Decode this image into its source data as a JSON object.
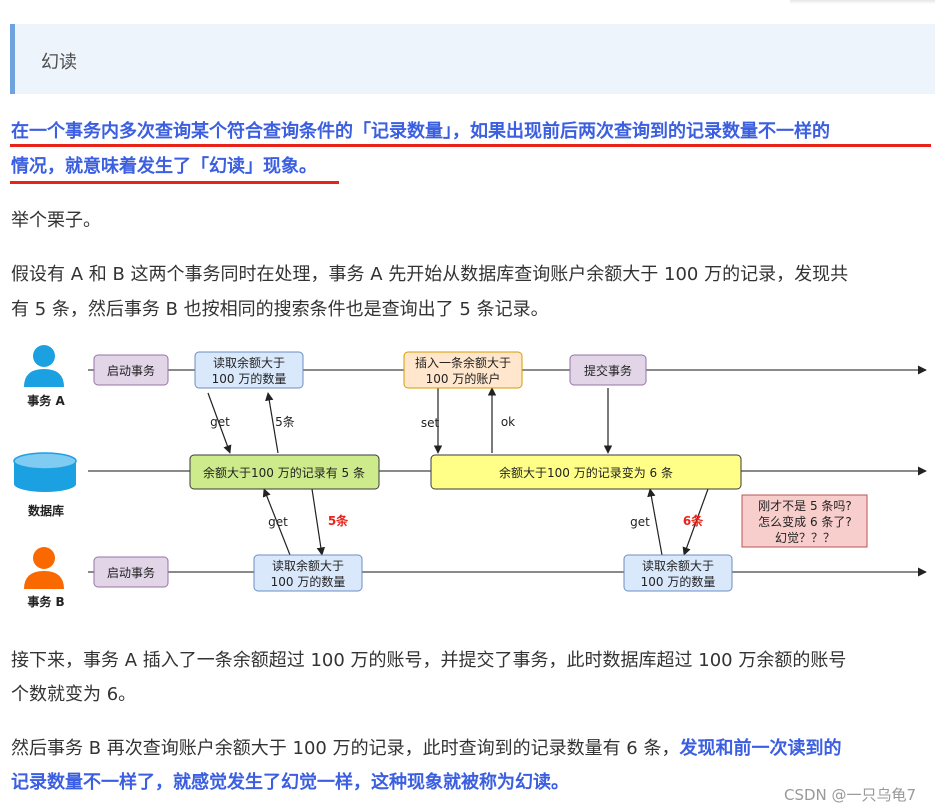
{
  "callout": {
    "text": "幻读"
  },
  "highlight": {
    "line1": "在一个事务内多次查询某个符合查询条件的「记录数量」，如果出现前后两次查询到的记录数量不一样的",
    "line2": "情况，就意味着发生了「幻读」现象。"
  },
  "example": "举个栗子。",
  "para1": {
    "line1": "假设有 A 和 B 这两个事务同时在处理，事务 A 先开始从数据库查询账户余额大于 100 万的记录，发现共",
    "line2": "有 5 条，然后事务 B 也按相同的搜索条件也是查询出了 5 条记录。"
  },
  "diagram": {
    "actors": {
      "a": "事务 A",
      "db": "数据库",
      "b": "事务 B"
    },
    "boxes": {
      "a_start": "启动事务",
      "a_read_l1": "读取余额大于",
      "a_read_l2": "100 万的数量",
      "a_insert_l1": "插入一条余额大于",
      "a_insert_l2": "100 万的账户",
      "a_commit": "提交事务",
      "db_5": "余额大于100 万的记录有 5 条",
      "db_6": "余额大于100 万的记录变为 6 条",
      "b_start": "启动事务",
      "b_read1_l1": "读取余额大于",
      "b_read1_l2": "100 万的数量",
      "b_read2_l1": "读取余额大于",
      "b_read2_l2": "100 万的数量",
      "note_l1": "刚才不是 5 条吗?",
      "note_l2": "怎么变成 6 条了?",
      "note_l3": "幻觉？？？"
    },
    "labels": {
      "get1": "get",
      "five1": "5条",
      "set": "set",
      "ok": "ok",
      "get2": "get",
      "five2": "5条",
      "get3": "get",
      "six": "6条"
    },
    "colors": {
      "start": "#e1d5e7",
      "read": "#dae8fc",
      "insert": "#ffe6cc",
      "db5": "#cdeb8b",
      "db6": "#ffff88",
      "note": "#f8cecc",
      "person_blue": "#1ba1e2",
      "person_orange": "#fa6800",
      "db_blue": "#1ba1e2",
      "red_text": "#e8231a"
    }
  },
  "para2": {
    "line1": "接下来，事务 A 插入了一条余额超过 100 万的账号，并提交了事务，此时数据库超过 100 万余额的账号",
    "line2": "个数就变为 6。"
  },
  "para3": {
    "line1_normal": "然后事务 B 再次查询账户余额大于 100 万的记录，此时查询到的记录数量有 6 条，",
    "line1_bold": "发现和前一次读到的",
    "line2_bold": "记录数量不一样了，就感觉发生了幻觉一样，这种现象就被称为幻读。"
  },
  "watermark": "CSDN @一只乌龟7"
}
